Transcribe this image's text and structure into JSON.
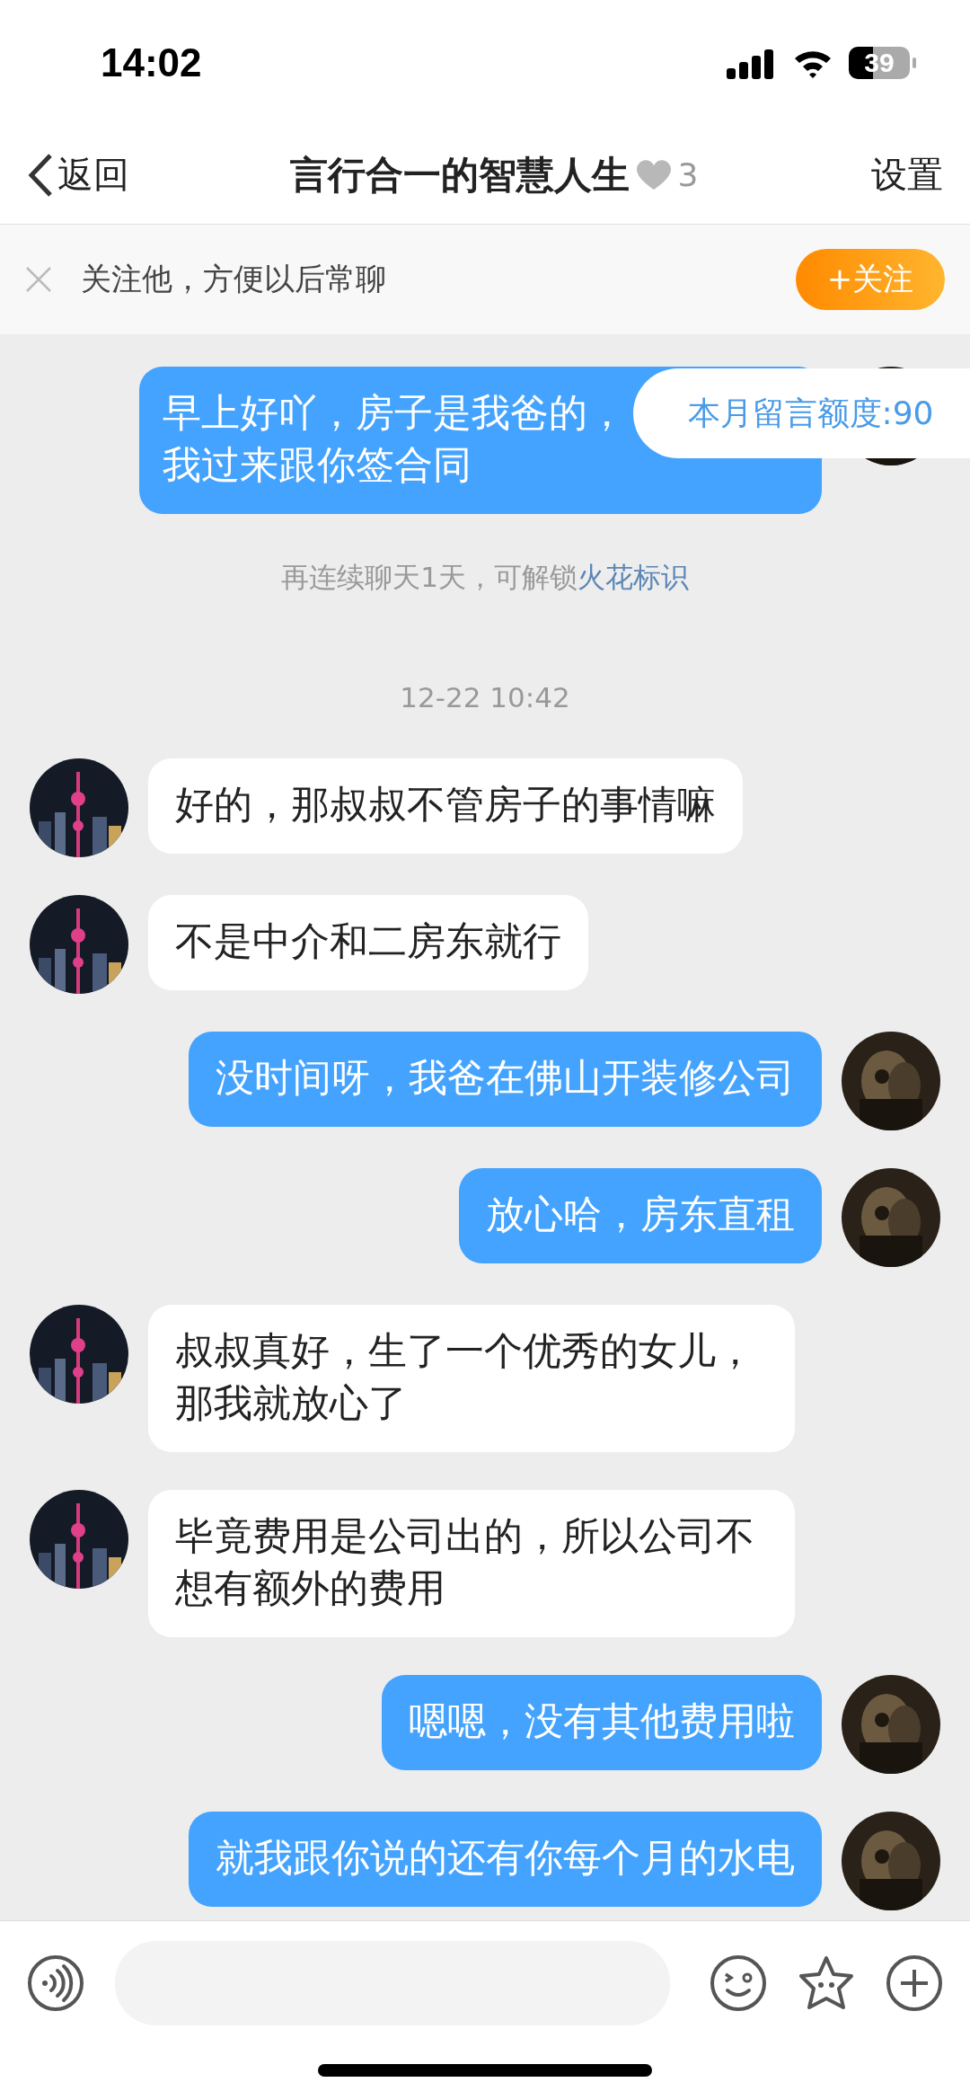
{
  "status_bar": {
    "time": "14:02",
    "battery": "39"
  },
  "nav": {
    "back": "返回",
    "title": "言行合一的智慧人生",
    "intimacy": "3",
    "settings": "设置"
  },
  "follow_banner": {
    "text": "关注他，方便以后常聊",
    "button": "+关注"
  },
  "quota_tip": "本月留言额度:90",
  "messages": [
    {
      "kind": "sent",
      "lines": [
        "早上好吖，房子是我爸的，",
        "我过来跟你签合同"
      ]
    },
    {
      "kind": "notice",
      "text": "再连续聊天1天，可解锁",
      "link": "火花标识"
    },
    {
      "kind": "time",
      "text": "12-22 10:42"
    },
    {
      "kind": "received",
      "text": "好的，那叔叔不管房子的事情嘛"
    },
    {
      "kind": "received",
      "text": "不是中介和二房东就行"
    },
    {
      "kind": "sent",
      "text": "没时间呀，我爸在佛山开装修公司"
    },
    {
      "kind": "sent",
      "text": "放心哈，房东直租"
    },
    {
      "kind": "received",
      "text": "叔叔真好，生了一个优秀的女儿，那我就放心了"
    },
    {
      "kind": "received",
      "text": "毕竟费用是公司出的，所以公司不想有额外的费用"
    },
    {
      "kind": "sent",
      "text": "嗯嗯，没有其他费用啦"
    },
    {
      "kind": "sent",
      "text": "就我跟你说的还有你每个月的水电"
    }
  ]
}
